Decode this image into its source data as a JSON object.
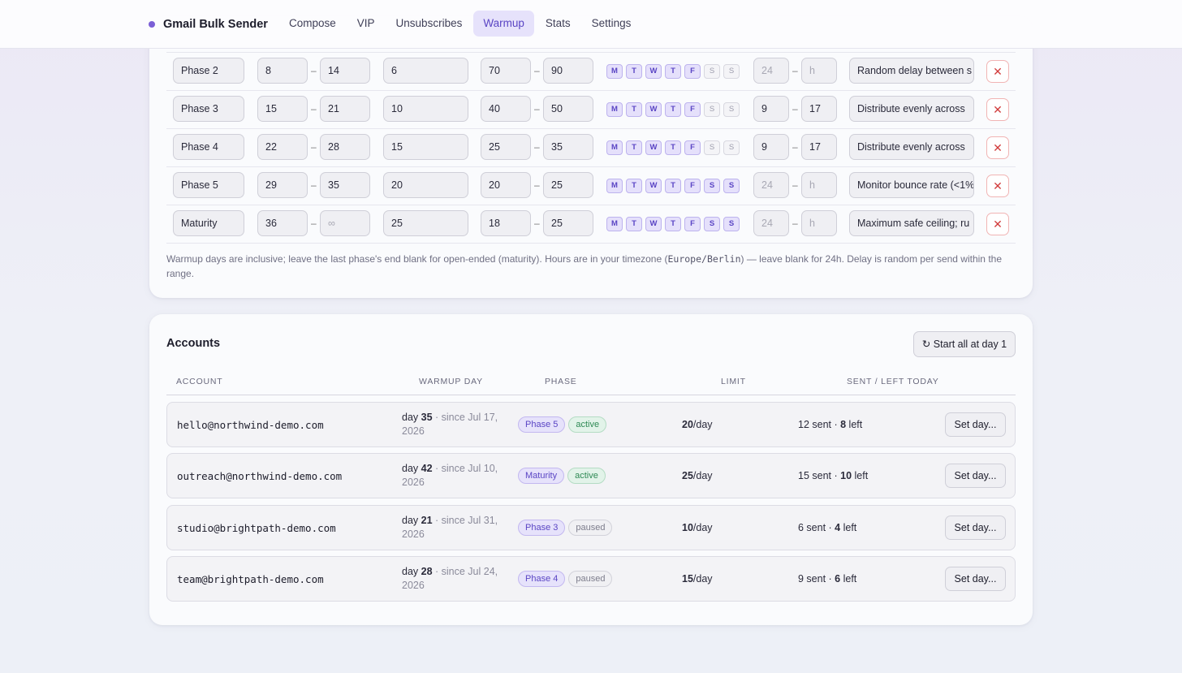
{
  "app": {
    "name": "Gmail Bulk Sender",
    "brand_color": "#7b5fd6"
  },
  "nav": [
    {
      "label": "Compose",
      "active": false
    },
    {
      "label": "VIP",
      "active": false
    },
    {
      "label": "Unsubscribes",
      "active": false
    },
    {
      "label": "Warmup",
      "active": true
    },
    {
      "label": "Stats",
      "active": false
    },
    {
      "label": "Settings",
      "active": false
    }
  ],
  "phases": {
    "range_separator": "–",
    "delete_label": "✕",
    "rows": [
      {
        "name": "Phase 2",
        "day_start": "8",
        "day_end": "14",
        "limit": "6",
        "delay_min": "70",
        "delay_max": "90",
        "days": [
          {
            "l": "M",
            "on": true
          },
          {
            "l": "T",
            "on": true
          },
          {
            "l": "W",
            "on": true
          },
          {
            "l": "T",
            "on": true
          },
          {
            "l": "F",
            "on": true
          },
          {
            "l": "S",
            "on": false
          },
          {
            "l": "S",
            "on": false
          }
        ],
        "hour_start": "",
        "hour_start_placeholder": "24",
        "hour_end": "",
        "hour_end_placeholder": "h",
        "note": "Random delay between s"
      },
      {
        "name": "Phase 3",
        "day_start": "15",
        "day_end": "21",
        "limit": "10",
        "delay_min": "40",
        "delay_max": "50",
        "days": [
          {
            "l": "M",
            "on": true
          },
          {
            "l": "T",
            "on": true
          },
          {
            "l": "W",
            "on": true
          },
          {
            "l": "T",
            "on": true
          },
          {
            "l": "F",
            "on": true
          },
          {
            "l": "S",
            "on": false
          },
          {
            "l": "S",
            "on": false
          }
        ],
        "hour_start": "9",
        "hour_start_placeholder": "",
        "hour_end": "17",
        "hour_end_placeholder": "",
        "note": "Distribute evenly across"
      },
      {
        "name": "Phase 4",
        "day_start": "22",
        "day_end": "28",
        "limit": "15",
        "delay_min": "25",
        "delay_max": "35",
        "days": [
          {
            "l": "M",
            "on": true
          },
          {
            "l": "T",
            "on": true
          },
          {
            "l": "W",
            "on": true
          },
          {
            "l": "T",
            "on": true
          },
          {
            "l": "F",
            "on": true
          },
          {
            "l": "S",
            "on": false
          },
          {
            "l": "S",
            "on": false
          }
        ],
        "hour_start": "9",
        "hour_start_placeholder": "",
        "hour_end": "17",
        "hour_end_placeholder": "",
        "note": "Distribute evenly across"
      },
      {
        "name": "Phase 5",
        "day_start": "29",
        "day_end": "35",
        "limit": "20",
        "delay_min": "20",
        "delay_max": "25",
        "days": [
          {
            "l": "M",
            "on": true
          },
          {
            "l": "T",
            "on": true
          },
          {
            "l": "W",
            "on": true
          },
          {
            "l": "T",
            "on": true
          },
          {
            "l": "F",
            "on": true
          },
          {
            "l": "S",
            "on": true
          },
          {
            "l": "S",
            "on": true
          }
        ],
        "hour_start": "",
        "hour_start_placeholder": "24",
        "hour_end": "",
        "hour_end_placeholder": "h",
        "note": "Monitor bounce rate (<1%"
      },
      {
        "name": "Maturity",
        "day_start": "36",
        "day_end": "",
        "day_end_placeholder": "∞",
        "limit": "25",
        "delay_min": "18",
        "delay_max": "25",
        "days": [
          {
            "l": "M",
            "on": true
          },
          {
            "l": "T",
            "on": true
          },
          {
            "l": "W",
            "on": true
          },
          {
            "l": "T",
            "on": true
          },
          {
            "l": "F",
            "on": true
          },
          {
            "l": "S",
            "on": true
          },
          {
            "l": "S",
            "on": true
          }
        ],
        "hour_start": "",
        "hour_start_placeholder": "24",
        "hour_end": "",
        "hour_end_placeholder": "h",
        "note": "Maximum safe ceiling; ru"
      }
    ],
    "help_before": "Warmup days are inclusive; leave the last phase's end blank for open-ended (maturity). Hours are in your timezone (",
    "timezone": "Europe/Berlin",
    "help_after": ") — leave blank for 24h. Delay is random per send within the range."
  },
  "accounts": {
    "title": "Accounts",
    "start_all_label": "↻ Start all at day 1",
    "headers": {
      "account": "ACCOUNT",
      "warmup_day": "WARMUP DAY",
      "phase": "PHASE",
      "limit": "LIMIT",
      "sent_left": "SENT / LEFT TODAY"
    },
    "rows": [
      {
        "email": "hello@northwind-demo.com",
        "day_prefix": "day ",
        "day": "35",
        "since": " · since Jul 17, 2026",
        "phase": "Phase 5",
        "status": "active",
        "limit": "20",
        "limit_suffix": "/day",
        "sent": "12 sent · ",
        "left": "8",
        "left_suffix": " left",
        "action": "Set day..."
      },
      {
        "email": "outreach@northwind-demo.com",
        "day_prefix": "day ",
        "day": "42",
        "since": " · since Jul 10, 2026",
        "phase": "Maturity",
        "status": "active",
        "limit": "25",
        "limit_suffix": "/day",
        "sent": "15 sent · ",
        "left": "10",
        "left_suffix": " left",
        "action": "Set day..."
      },
      {
        "email": "studio@brightpath-demo.com",
        "day_prefix": "day ",
        "day": "21",
        "since": " · since Jul 31, 2026",
        "phase": "Phase 3",
        "status": "paused",
        "limit": "10",
        "limit_suffix": "/day",
        "sent": "6 sent · ",
        "left": "4",
        "left_suffix": " left",
        "action": "Set day..."
      },
      {
        "email": "team@brightpath-demo.com",
        "day_prefix": "day ",
        "day": "28",
        "since": " · since Jul 24, 2026",
        "phase": "Phase 4",
        "status": "paused",
        "limit": "15",
        "limit_suffix": "/day",
        "sent": "9 sent · ",
        "left": "6",
        "left_suffix": " left",
        "action": "Set day..."
      }
    ]
  }
}
